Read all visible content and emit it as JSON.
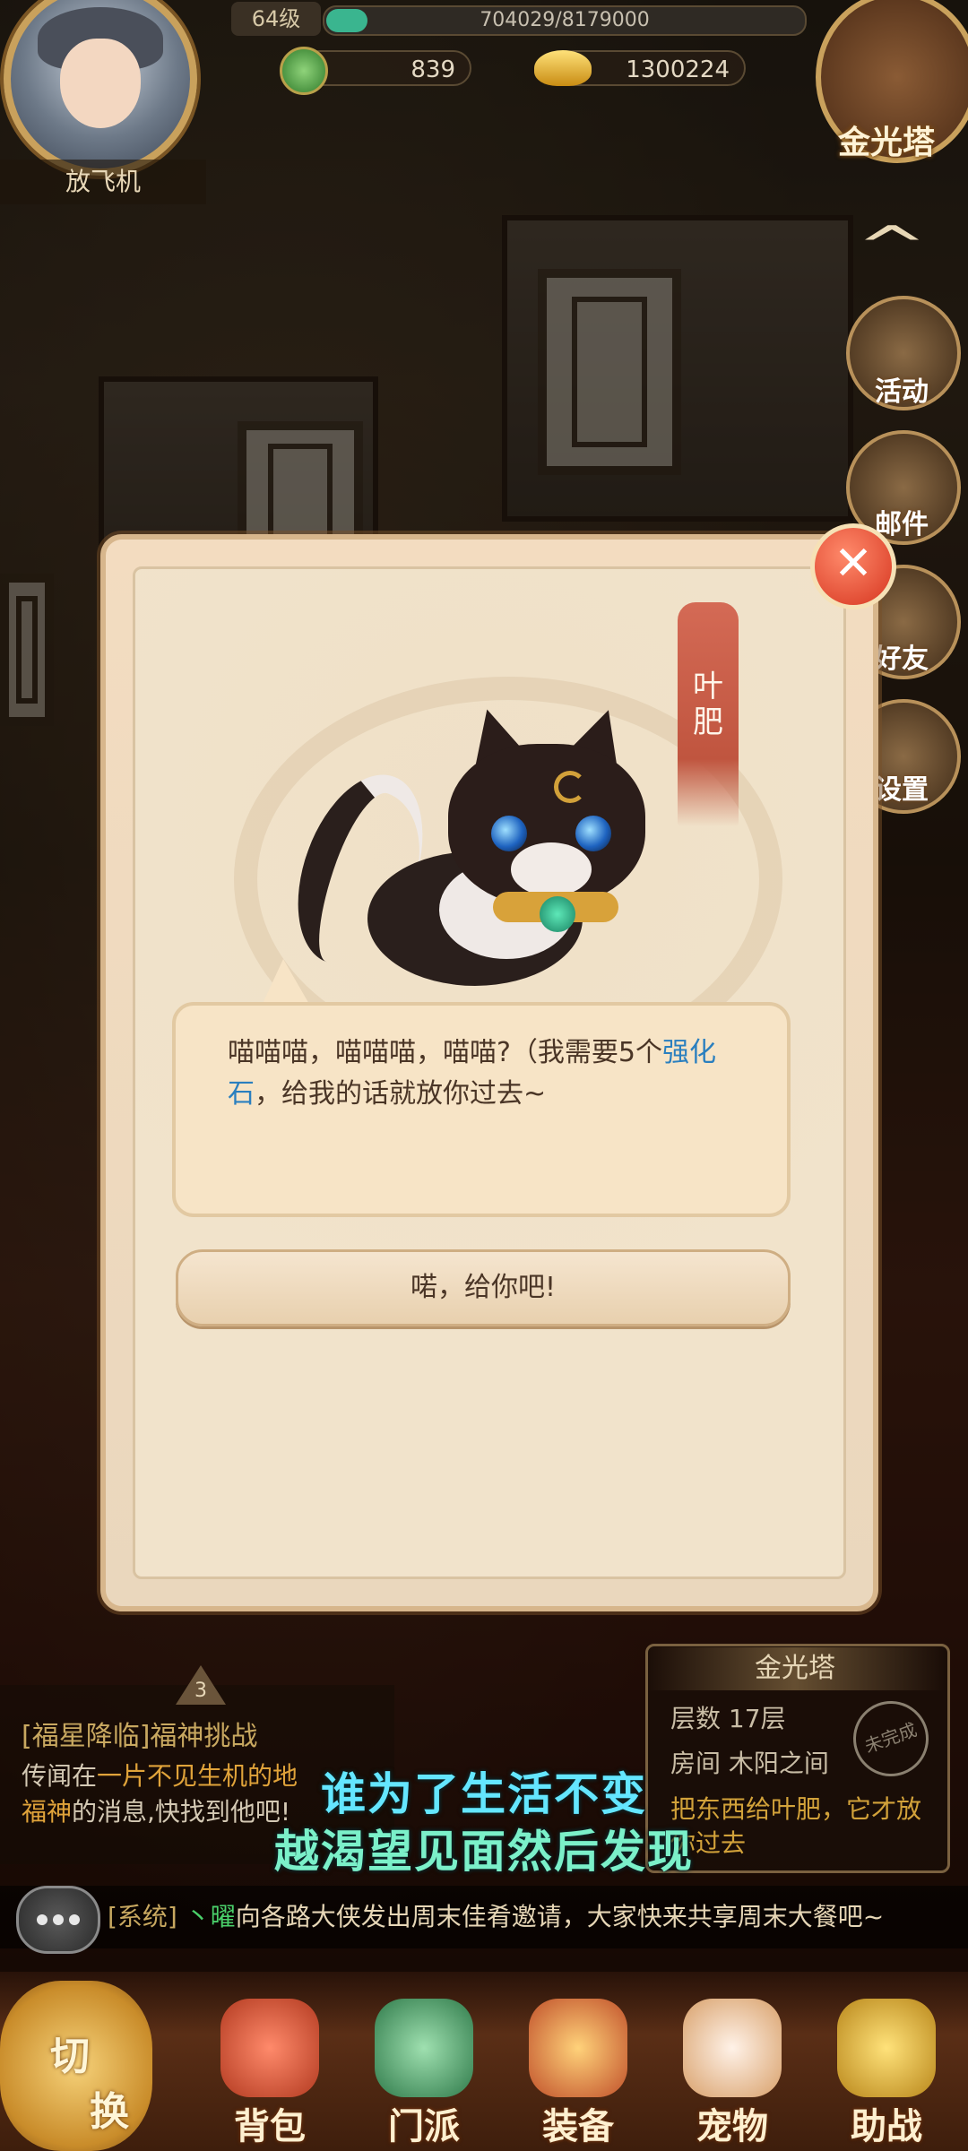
{
  "hud": {
    "player_name": "放飞机",
    "level": "64级",
    "exp_text": "704029/8179000",
    "exp_fraction": 0.086,
    "currency_jade": "839",
    "currency_gold": "1300224",
    "tower_label": "金光塔"
  },
  "side_menu": {
    "activity": "活动",
    "mail": "邮件",
    "friends": "好友",
    "settings": "设置"
  },
  "dialog": {
    "npc_name": "叶肥",
    "speech_before": "喵喵喵，喵喵喵，喵喵?（我需要5个",
    "speech_highlight": "强化石",
    "speech_after": "，给我的话就放你过去~",
    "confirm_button": "喏，给你吧!"
  },
  "quest": {
    "badge": "3",
    "title": "[福星降临]福神挑战",
    "desc_part1": "传闻在",
    "desc_highlight1": "一片不见生机的地",
    "desc_part2": "",
    "desc_highlight2": "福神",
    "desc_part3": "的消息,快找到他吧!"
  },
  "floor_info": {
    "title": "金光塔",
    "floor": "层数 17层",
    "room": "房间 木阳之间",
    "task": "把东西给叶肥，它才放你过去",
    "stamp": "未完成"
  },
  "lyrics": {
    "line1": "谁为了生活不变",
    "line2": "越渴望见面然后发现"
  },
  "chat": {
    "channel": "[系统]",
    "user": "丶曜",
    "message": "向各路大侠发出周末佳肴邀请，大家快来共享周末大餐吧~"
  },
  "bottom_menu": {
    "switch_top": "切",
    "switch_bottom": "换",
    "items": [
      "背包",
      "门派",
      "装备",
      "宠物",
      "助战"
    ]
  },
  "colors": {
    "highlight_blue": "#2a7fbf",
    "quest_gold": "#c8a860",
    "lyric_cyan": "#64e6ff",
    "chat_user_green": "#4ad06a",
    "close_red": "#d6351f"
  }
}
